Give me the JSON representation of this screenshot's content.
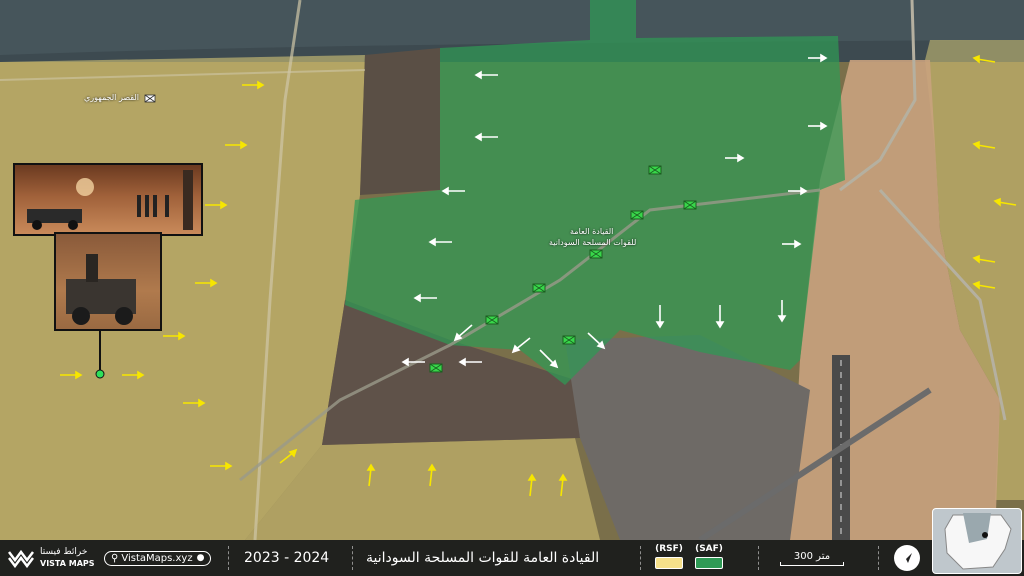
{
  "map": {
    "labels": {
      "palace": "القصر الجمهوري",
      "hq_line1": "القيادة العامة",
      "hq_line2": "للقوات المسلحة السودانية"
    },
    "areas": [
      {
        "name": "RSF",
        "color": "#f5e08a"
      },
      {
        "name": "SAF",
        "color": "#2f9a55"
      }
    ]
  },
  "bottom_bar": {
    "logo_ar": "خرائط فيستا",
    "logo_en": "VISTA MAPS",
    "site": "VistaMaps.xyz",
    "years": "2023 - 2024",
    "title": "القيادة العامة للقوات المسلحة السودانية",
    "legend_rsf": "(RSF)",
    "legend_saf": "(SAF)",
    "scale": "300 متر"
  }
}
